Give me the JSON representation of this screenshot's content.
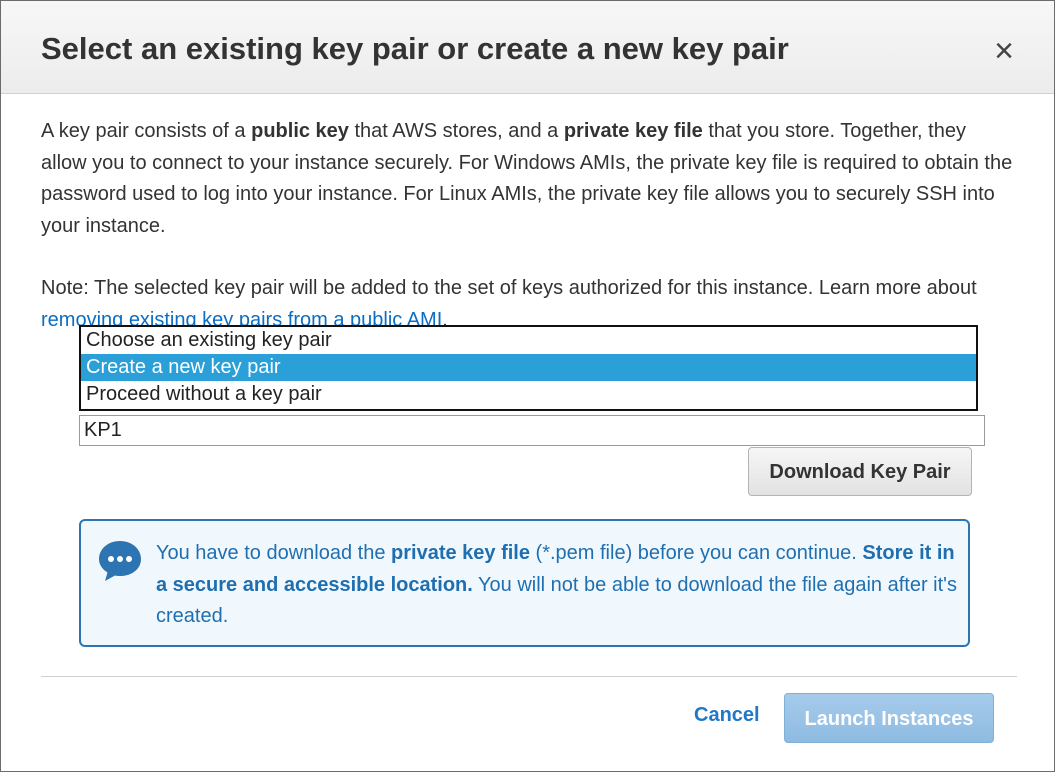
{
  "dialog": {
    "title": "Select an existing key pair or create a new key pair",
    "close_label": "×"
  },
  "intro": {
    "t1": "A key pair consists of a ",
    "b1": "public key",
    "t2": " that AWS stores, and a ",
    "b2": "private key file",
    "t3": " that you store. Together, they allow you to connect to your instance securely. For Windows AMIs, the private key file is required to obtain the password used to log into your instance. For Linux AMIs, the private key file allows you to securely SSH into your instance."
  },
  "note": {
    "text": "Note: The selected key pair will be added to the set of keys authorized for this instance. Learn more about ",
    "link": "removing existing key pairs from a public AMI",
    "end": "."
  },
  "key_pair_options": {
    "options": [
      "Choose an existing key pair",
      "Create a new key pair",
      "Proceed without a key pair"
    ],
    "selected": "Create a new key pair"
  },
  "key_pair_name": {
    "value": "KP1"
  },
  "download_button": {
    "label": "Download Key Pair"
  },
  "info": {
    "icon": "speech-bubble-icon",
    "t1": "You have to download the ",
    "b1": "private key file",
    "t2": " (*.pem file) before you can continue. ",
    "b2": "Store it in a secure and accessible location.",
    "t3": " You will not be able to download the file again after it's created."
  },
  "footer": {
    "cancel_label": "Cancel",
    "launch_label": "Launch Instances"
  },
  "colors": {
    "selected_option": "#2a9fd8",
    "info_text": "#1f6fb0",
    "info_border": "#2c74b2",
    "link": "#0b6ec5",
    "launch_disabled": "#98c2e6"
  }
}
